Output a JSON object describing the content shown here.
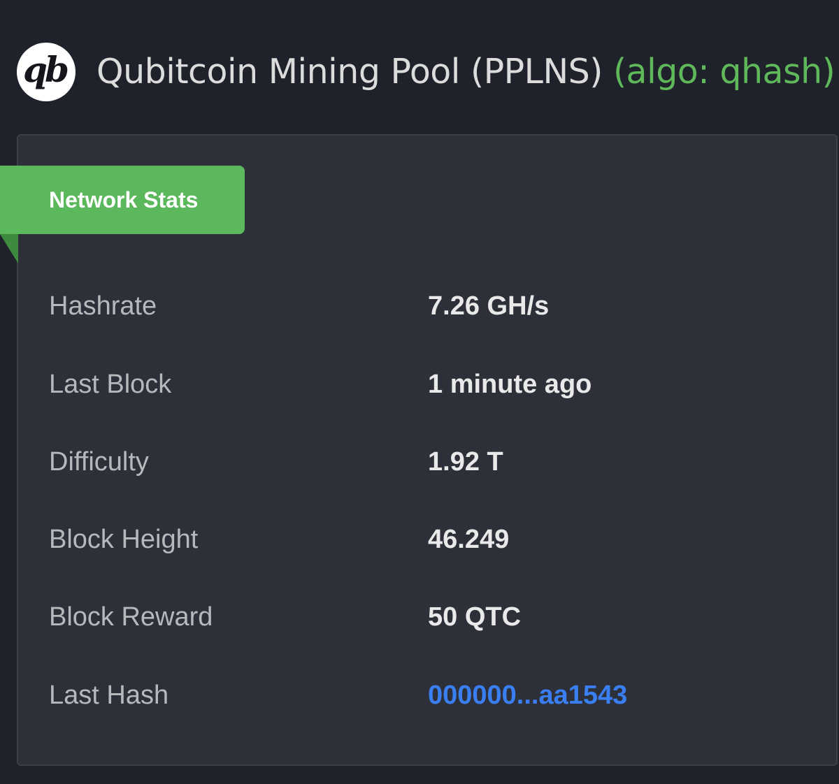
{
  "header": {
    "logo_text": "qb",
    "title": "Qubitcoin Mining Pool (PPLNS)",
    "algo": "(algo: qhash)"
  },
  "network_stats": {
    "heading": "Network Stats",
    "rows": [
      {
        "label": "Hashrate",
        "value": "7.26 GH/s"
      },
      {
        "label": "Last Block",
        "value": "1 minute ago"
      },
      {
        "label": "Difficulty",
        "value": "1.92 T"
      },
      {
        "label": "Block Height",
        "value": "46.249"
      },
      {
        "label": "Block Reward",
        "value": "50 QTC"
      },
      {
        "label": "Last Hash",
        "value": "000000...aa1543"
      }
    ]
  },
  "colors": {
    "background": "#1f222a",
    "panel": "#2d3038",
    "accent_green": "#5cb85c",
    "link_blue": "#3a7ff2"
  }
}
